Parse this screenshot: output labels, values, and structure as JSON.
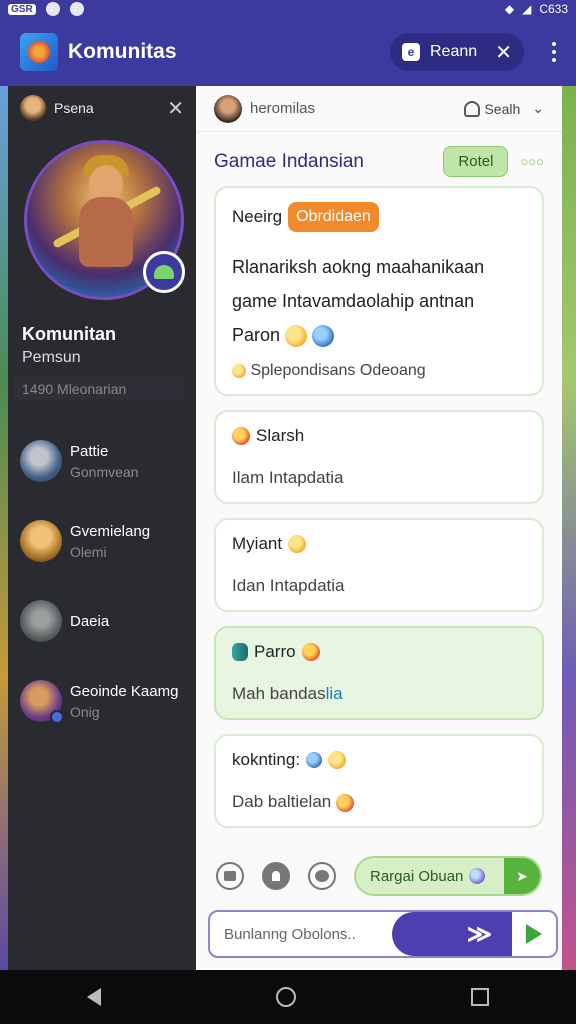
{
  "status_bar": {
    "left_chip": "GSR",
    "battery_text": "C633"
  },
  "app_bar": {
    "title": "Komunitas",
    "room_label": "Reann",
    "room_icon_label": "e"
  },
  "colors": {
    "primary": "#3c3a9e",
    "accent_green": "#58b33d",
    "tag_orange": "#f08a2a"
  },
  "sidebar": {
    "header_name": "Psena",
    "profile_name": "Komunitan",
    "profile_sub": "Pemsun",
    "member_count": "1490 Mleonarian",
    "contacts": [
      {
        "name": "Pattie",
        "sub": "Gonmvean"
      },
      {
        "name": "Gvemielang",
        "sub": "Olemi"
      },
      {
        "name": "Daeia",
        "sub": ""
      },
      {
        "name": "Geoinde Kaamg",
        "sub": "Onig"
      }
    ]
  },
  "chat": {
    "header_name": "heromilas",
    "header_action": "Sealh",
    "group_title": "Gamae Indansian",
    "group_button": "Rotel",
    "messages": [
      {
        "author": "Neeirg",
        "tag": "Obrdidaen",
        "body_line1": "Rlanariksh aokng maahanikaan",
        "body_line2": "game Intavamdaolahip antnan",
        "body_line3": "Paron",
        "footer": "Splepondisans Odeoang"
      },
      {
        "author": "Slarsh",
        "body": "Ilam Intapdatia"
      },
      {
        "author": "Myiant",
        "body": "Idan Intapdatia"
      },
      {
        "author": "Parro",
        "body_plain": "Mah bandas",
        "body_link": "lia"
      },
      {
        "author": "koknting:",
        "body": "Dab baltielan"
      }
    ]
  },
  "toolbar": {
    "pill_label": "Rargai Obuan"
  },
  "input": {
    "placeholder": "Bunlanng Obolons.."
  }
}
